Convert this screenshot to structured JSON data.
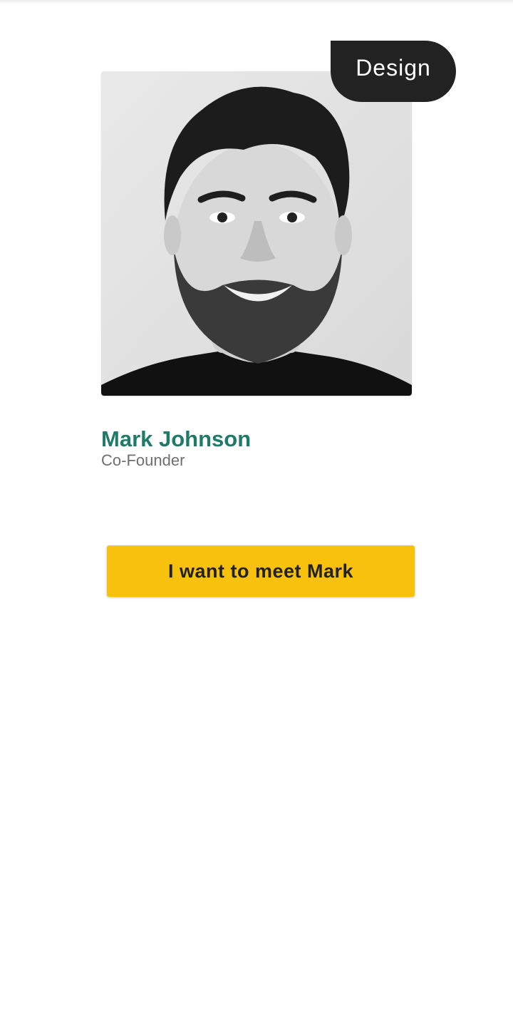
{
  "card": {
    "tag": "Design",
    "name": "Mark Johnson",
    "role": "Co-Founder",
    "photo_alt": "Mark Johnson",
    "cta_label": "I want to meet Mark"
  },
  "colors": {
    "name": "#1f7a68",
    "role": "#6f6f6f",
    "tag_background": "#222222",
    "cta_background": "#f8c10e",
    "cta_text": "#222222"
  }
}
